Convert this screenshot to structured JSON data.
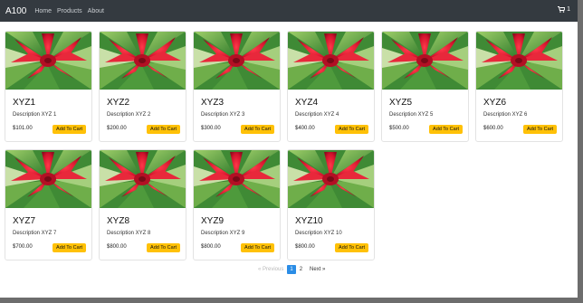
{
  "navbar": {
    "brand": "A100",
    "links": [
      "Home",
      "Products",
      "About"
    ],
    "cart_count": "1"
  },
  "colors": {
    "navbar_bg": "#343a40",
    "button_bg": "#ffc107",
    "pager_active": "#2b8de6"
  },
  "button_label": "Add To Cart",
  "products": [
    {
      "title": "XYZ1",
      "description": "Description XYZ 1",
      "price": "$101.00"
    },
    {
      "title": "XYZ2",
      "description": "Description XYZ 2",
      "price": "$200.00"
    },
    {
      "title": "XYZ3",
      "description": "Description XYZ 3",
      "price": "$300.00"
    },
    {
      "title": "XYZ4",
      "description": "Description XYZ 4",
      "price": "$400.00"
    },
    {
      "title": "XYZ5",
      "description": "Description XYZ 5",
      "price": "$500.00"
    },
    {
      "title": "XYZ6",
      "description": "Description XYZ 6",
      "price": "$600.00"
    },
    {
      "title": "XYZ7",
      "description": "Description XYZ 7",
      "price": "$700.00"
    },
    {
      "title": "XYZ8",
      "description": "Description XYZ 8",
      "price": "$800.00"
    },
    {
      "title": "XYZ9",
      "description": "Description XYZ 9",
      "price": "$800.00"
    },
    {
      "title": "XYZ10",
      "description": "Description XYZ 10",
      "price": "$800.00"
    }
  ],
  "pagination": {
    "previous": "« Previous",
    "pages": [
      "1",
      "2"
    ],
    "active_page": "1",
    "next": "Next »"
  }
}
